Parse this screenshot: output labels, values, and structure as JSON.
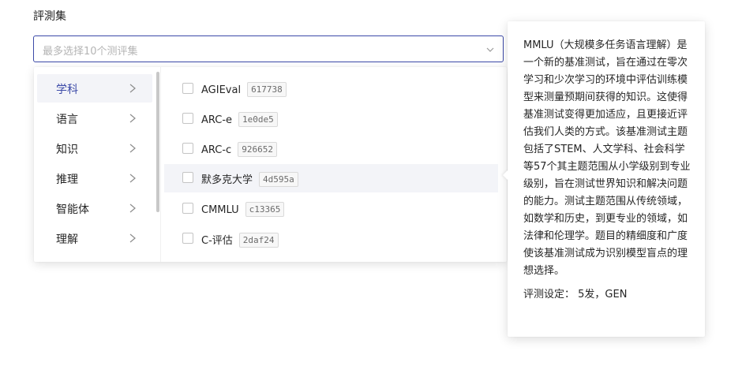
{
  "form": {
    "label": "評測集",
    "placeholder": "最多选择10个测评集"
  },
  "categories": [
    {
      "label": "学科",
      "active": true
    },
    {
      "label": "语言",
      "active": false
    },
    {
      "label": "知识",
      "active": false
    },
    {
      "label": "推理",
      "active": false
    },
    {
      "label": "智能体",
      "active": false
    },
    {
      "label": "理解",
      "active": false
    }
  ],
  "options": [
    {
      "name": "AGIEval",
      "tag": "617738",
      "checked": false
    },
    {
      "name": "ARC-e",
      "tag": "1e0de5",
      "checked": false
    },
    {
      "name": "ARC-c",
      "tag": "926652",
      "checked": false
    },
    {
      "name": "默多克大学",
      "tag": "4d595a",
      "checked": false
    },
    {
      "name": "CMMLU",
      "tag": "c13365",
      "checked": false
    },
    {
      "name": "C-评估",
      "tag": "2daf24",
      "checked": false
    }
  ],
  "tooltip": {
    "description": "MMLU（大规模多任务语言理解）是一个新的基准测试，旨在通过在零次学习和少次学习的环境中评估训练模型来测量预期间获得的知识。这使得基准测试变得更加适应，且更接近评估我们人类的方式。该基准测试主题包括了STEM、人文学科、社会科学等57个其主题范围从小学级别到专业级别，旨在测试世界知识和解决问题的能力。测试主题范围从传统领域，如数学和历史，到更专业的领域，如法律和伦理学。题目的精细度和广度使该基准测试成为识别模型盲点的理想选择。",
    "setting_label": "评测设定：",
    "setting_value": "5发，GEN"
  },
  "colors": {
    "accent": "#3c4aa8",
    "active_bg": "#f3f4f8"
  }
}
